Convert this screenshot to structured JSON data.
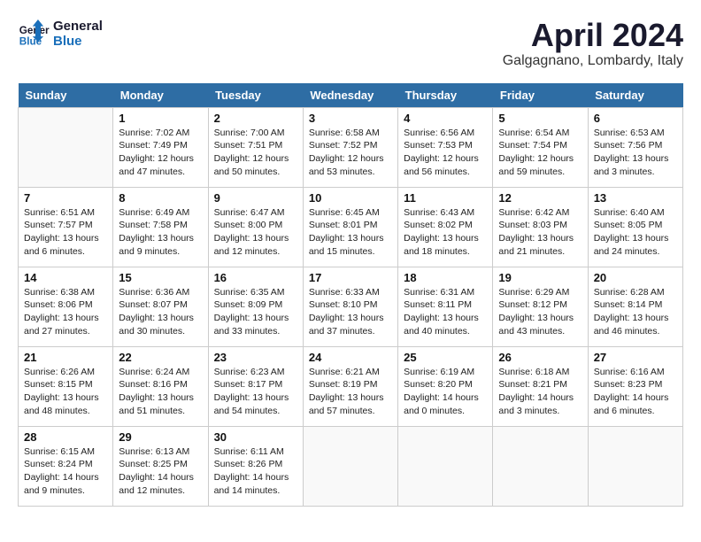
{
  "logo": {
    "line1": "General",
    "line2": "Blue"
  },
  "title": "April 2024",
  "subtitle": "Galgagnano, Lombardy, Italy",
  "weekdays": [
    "Sunday",
    "Monday",
    "Tuesday",
    "Wednesday",
    "Thursday",
    "Friday",
    "Saturday"
  ],
  "weeks": [
    [
      {
        "day": "",
        "info": ""
      },
      {
        "day": "1",
        "info": "Sunrise: 7:02 AM\nSunset: 7:49 PM\nDaylight: 12 hours\nand 47 minutes."
      },
      {
        "day": "2",
        "info": "Sunrise: 7:00 AM\nSunset: 7:51 PM\nDaylight: 12 hours\nand 50 minutes."
      },
      {
        "day": "3",
        "info": "Sunrise: 6:58 AM\nSunset: 7:52 PM\nDaylight: 12 hours\nand 53 minutes."
      },
      {
        "day": "4",
        "info": "Sunrise: 6:56 AM\nSunset: 7:53 PM\nDaylight: 12 hours\nand 56 minutes."
      },
      {
        "day": "5",
        "info": "Sunrise: 6:54 AM\nSunset: 7:54 PM\nDaylight: 12 hours\nand 59 minutes."
      },
      {
        "day": "6",
        "info": "Sunrise: 6:53 AM\nSunset: 7:56 PM\nDaylight: 13 hours\nand 3 minutes."
      }
    ],
    [
      {
        "day": "7",
        "info": "Sunrise: 6:51 AM\nSunset: 7:57 PM\nDaylight: 13 hours\nand 6 minutes."
      },
      {
        "day": "8",
        "info": "Sunrise: 6:49 AM\nSunset: 7:58 PM\nDaylight: 13 hours\nand 9 minutes."
      },
      {
        "day": "9",
        "info": "Sunrise: 6:47 AM\nSunset: 8:00 PM\nDaylight: 13 hours\nand 12 minutes."
      },
      {
        "day": "10",
        "info": "Sunrise: 6:45 AM\nSunset: 8:01 PM\nDaylight: 13 hours\nand 15 minutes."
      },
      {
        "day": "11",
        "info": "Sunrise: 6:43 AM\nSunset: 8:02 PM\nDaylight: 13 hours\nand 18 minutes."
      },
      {
        "day": "12",
        "info": "Sunrise: 6:42 AM\nSunset: 8:03 PM\nDaylight: 13 hours\nand 21 minutes."
      },
      {
        "day": "13",
        "info": "Sunrise: 6:40 AM\nSunset: 8:05 PM\nDaylight: 13 hours\nand 24 minutes."
      }
    ],
    [
      {
        "day": "14",
        "info": "Sunrise: 6:38 AM\nSunset: 8:06 PM\nDaylight: 13 hours\nand 27 minutes."
      },
      {
        "day": "15",
        "info": "Sunrise: 6:36 AM\nSunset: 8:07 PM\nDaylight: 13 hours\nand 30 minutes."
      },
      {
        "day": "16",
        "info": "Sunrise: 6:35 AM\nSunset: 8:09 PM\nDaylight: 13 hours\nand 33 minutes."
      },
      {
        "day": "17",
        "info": "Sunrise: 6:33 AM\nSunset: 8:10 PM\nDaylight: 13 hours\nand 37 minutes."
      },
      {
        "day": "18",
        "info": "Sunrise: 6:31 AM\nSunset: 8:11 PM\nDaylight: 13 hours\nand 40 minutes."
      },
      {
        "day": "19",
        "info": "Sunrise: 6:29 AM\nSunset: 8:12 PM\nDaylight: 13 hours\nand 43 minutes."
      },
      {
        "day": "20",
        "info": "Sunrise: 6:28 AM\nSunset: 8:14 PM\nDaylight: 13 hours\nand 46 minutes."
      }
    ],
    [
      {
        "day": "21",
        "info": "Sunrise: 6:26 AM\nSunset: 8:15 PM\nDaylight: 13 hours\nand 48 minutes."
      },
      {
        "day": "22",
        "info": "Sunrise: 6:24 AM\nSunset: 8:16 PM\nDaylight: 13 hours\nand 51 minutes."
      },
      {
        "day": "23",
        "info": "Sunrise: 6:23 AM\nSunset: 8:17 PM\nDaylight: 13 hours\nand 54 minutes."
      },
      {
        "day": "24",
        "info": "Sunrise: 6:21 AM\nSunset: 8:19 PM\nDaylight: 13 hours\nand 57 minutes."
      },
      {
        "day": "25",
        "info": "Sunrise: 6:19 AM\nSunset: 8:20 PM\nDaylight: 14 hours\nand 0 minutes."
      },
      {
        "day": "26",
        "info": "Sunrise: 6:18 AM\nSunset: 8:21 PM\nDaylight: 14 hours\nand 3 minutes."
      },
      {
        "day": "27",
        "info": "Sunrise: 6:16 AM\nSunset: 8:23 PM\nDaylight: 14 hours\nand 6 minutes."
      }
    ],
    [
      {
        "day": "28",
        "info": "Sunrise: 6:15 AM\nSunset: 8:24 PM\nDaylight: 14 hours\nand 9 minutes."
      },
      {
        "day": "29",
        "info": "Sunrise: 6:13 AM\nSunset: 8:25 PM\nDaylight: 14 hours\nand 12 minutes."
      },
      {
        "day": "30",
        "info": "Sunrise: 6:11 AM\nSunset: 8:26 PM\nDaylight: 14 hours\nand 14 minutes."
      },
      {
        "day": "",
        "info": ""
      },
      {
        "day": "",
        "info": ""
      },
      {
        "day": "",
        "info": ""
      },
      {
        "day": "",
        "info": ""
      }
    ]
  ]
}
